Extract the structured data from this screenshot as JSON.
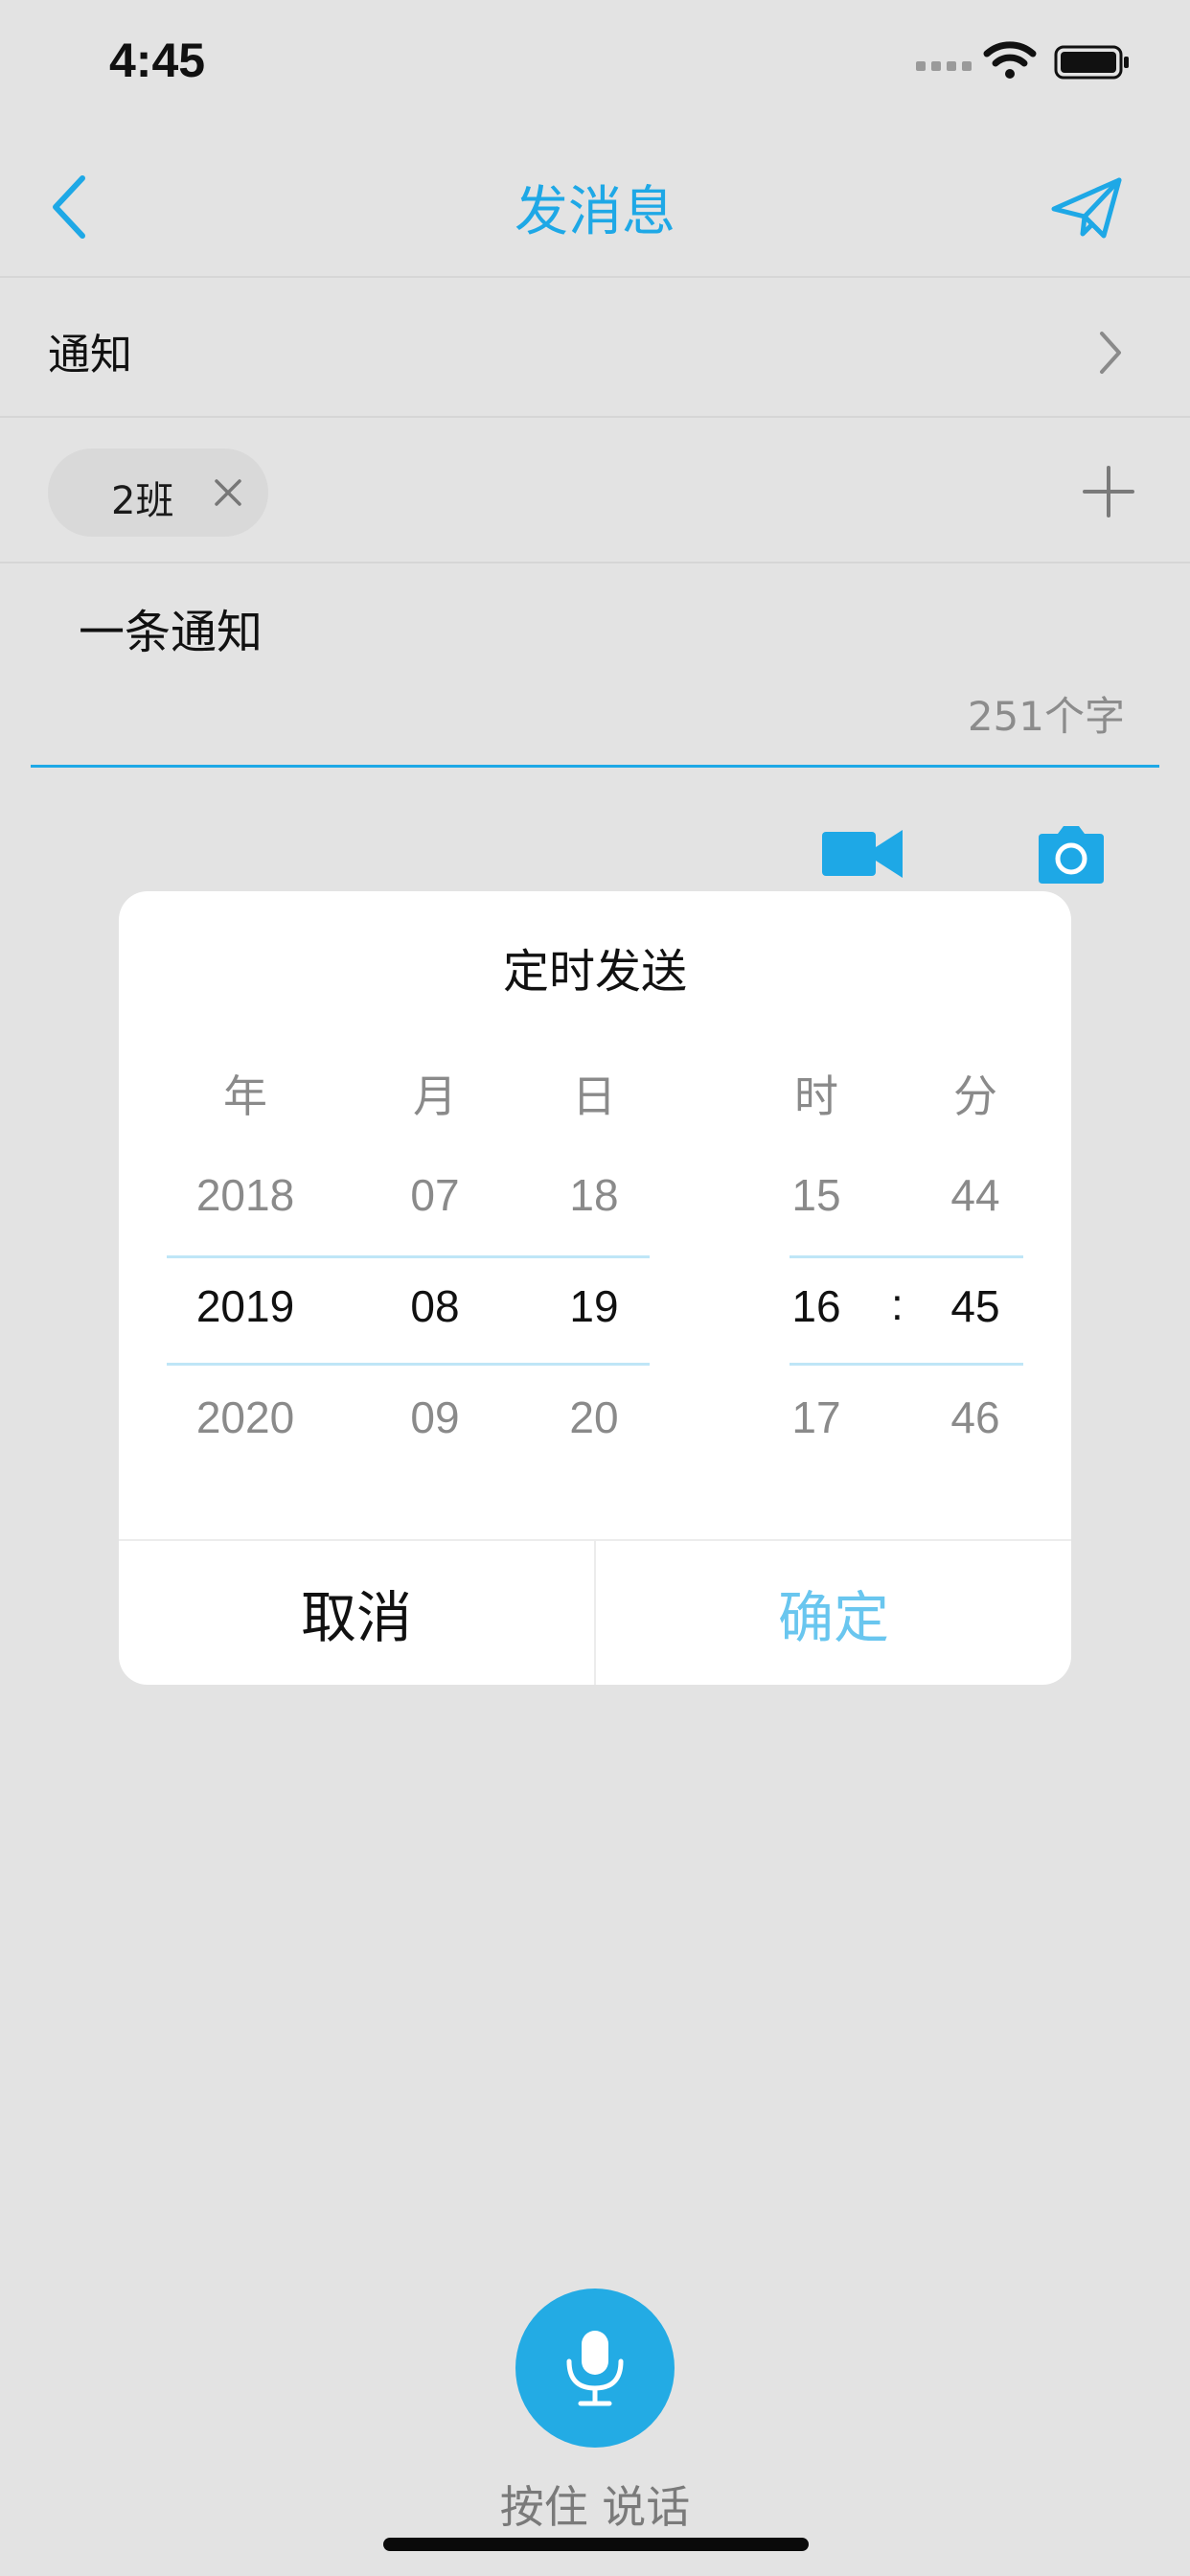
{
  "status_bar": {
    "time": "4:45"
  },
  "nav": {
    "title": "发消息"
  },
  "type_row": {
    "label": "通知"
  },
  "recipients": {
    "chip_label": "2班"
  },
  "message": {
    "text": "一条通知",
    "char_count": "251个字"
  },
  "picker": {
    "title": "定时发送",
    "columns": {
      "year": {
        "header": "年",
        "prev": "2018",
        "selected": "2019",
        "next": "2020"
      },
      "month": {
        "header": "月",
        "prev": "07",
        "selected": "08",
        "next": "09"
      },
      "day": {
        "header": "日",
        "prev": "18",
        "selected": "19",
        "next": "20"
      },
      "hour": {
        "header": "时",
        "prev": "15",
        "selected": "16",
        "next": "17"
      },
      "minute": {
        "header": "分",
        "prev": "44",
        "selected": "45",
        "next": "46"
      }
    },
    "separator": ":",
    "cancel_label": "取消",
    "confirm_label": "确定"
  },
  "voice": {
    "label": "按住 说话"
  },
  "colors": {
    "accent": "#1ea8e6",
    "confirm": "#69c6ef",
    "background": "#e3e3e3",
    "mic_button": "#23abe4"
  },
  "icons": [
    "back-icon",
    "send-icon",
    "chevron-right-icon",
    "close-icon",
    "add-icon",
    "video-icon",
    "camera-icon",
    "microphone-icon",
    "wifi-icon",
    "battery-icon"
  ]
}
